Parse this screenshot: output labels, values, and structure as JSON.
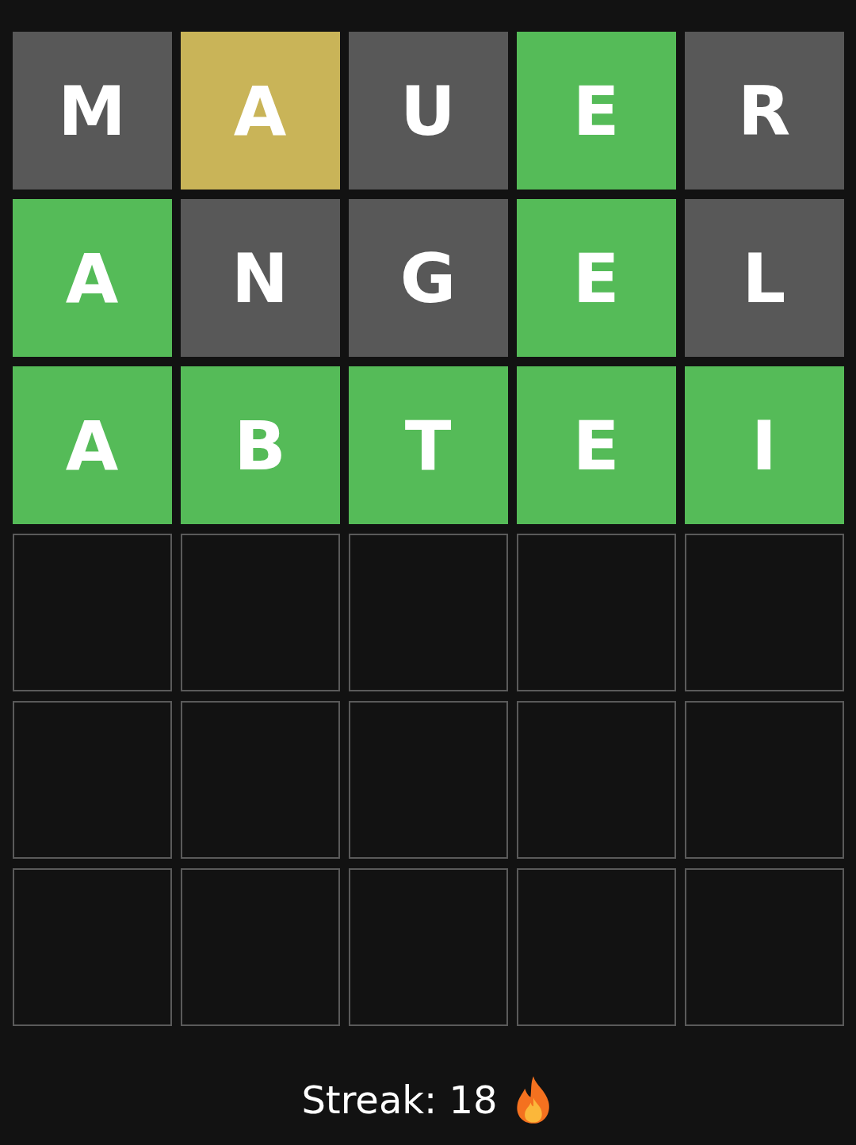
{
  "board": [
    {
      "tiles": [
        {
          "letter": "M",
          "kind": "absent"
        },
        {
          "letter": "A",
          "kind": "present"
        },
        {
          "letter": "U",
          "kind": "absent"
        },
        {
          "letter": "E",
          "kind": "correct"
        },
        {
          "letter": "R",
          "kind": "absent"
        }
      ]
    },
    {
      "tiles": [
        {
          "letter": "A",
          "kind": "correct"
        },
        {
          "letter": "N",
          "kind": "absent"
        },
        {
          "letter": "G",
          "kind": "absent"
        },
        {
          "letter": "E",
          "kind": "correct"
        },
        {
          "letter": "L",
          "kind": "absent"
        }
      ]
    },
    {
      "tiles": [
        {
          "letter": "A",
          "kind": "correct"
        },
        {
          "letter": "B",
          "kind": "correct"
        },
        {
          "letter": "T",
          "kind": "correct"
        },
        {
          "letter": "E",
          "kind": "correct"
        },
        {
          "letter": "I",
          "kind": "correct"
        }
      ]
    },
    {
      "tiles": [
        {
          "kind": "empty"
        },
        {
          "kind": "empty"
        },
        {
          "kind": "empty"
        },
        {
          "kind": "empty"
        },
        {
          "kind": "empty"
        }
      ]
    },
    {
      "tiles": [
        {
          "kind": "empty"
        },
        {
          "kind": "empty"
        },
        {
          "kind": "empty"
        },
        {
          "kind": "empty"
        },
        {
          "kind": "empty"
        }
      ]
    },
    {
      "tiles": [
        {
          "kind": "empty"
        },
        {
          "kind": "empty"
        },
        {
          "kind": "empty"
        },
        {
          "kind": "empty"
        },
        {
          "kind": "empty"
        }
      ]
    }
  ],
  "streak": {
    "label": "Streak: 18"
  }
}
